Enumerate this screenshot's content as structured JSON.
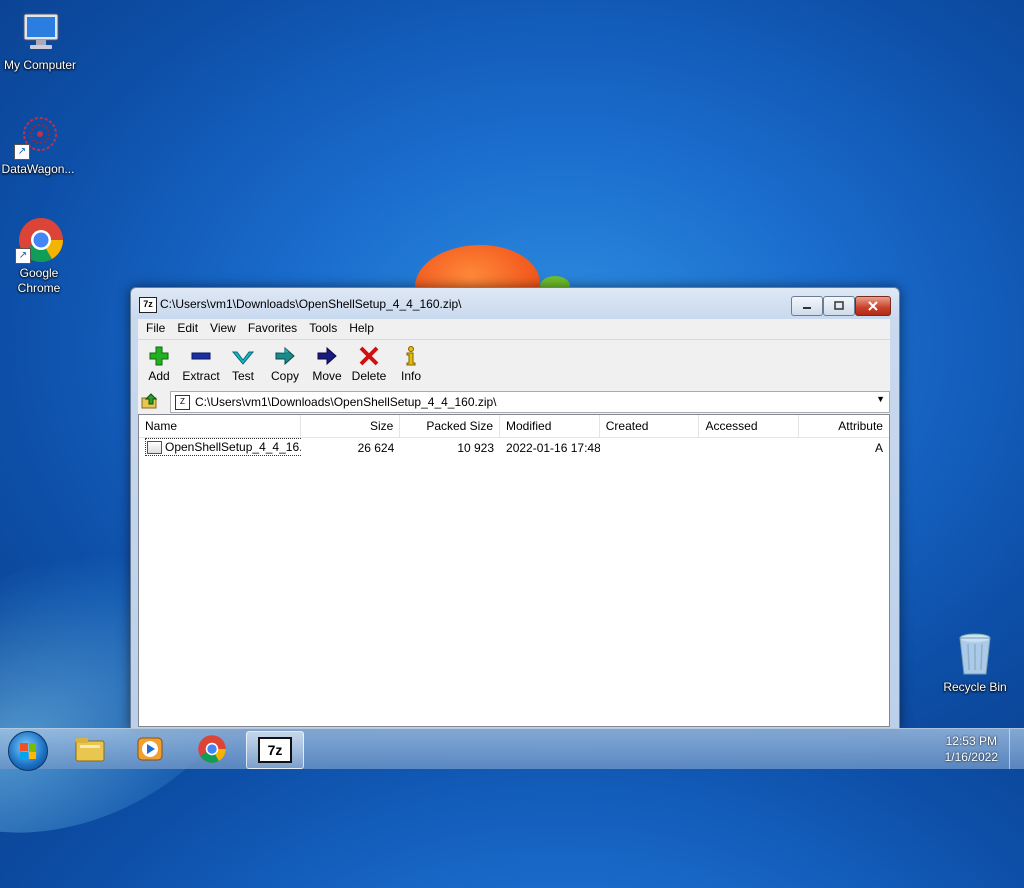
{
  "desktop": {
    "icons": [
      {
        "label": "My Computer"
      },
      {
        "label": "DataWagon..."
      },
      {
        "label": "Google Chrome"
      },
      {
        "label": "Recycle Bin"
      }
    ]
  },
  "window": {
    "title": "C:\\Users\\vm1\\Downloads\\OpenShellSetup_4_4_160.zip\\",
    "app_icon_text": "7z",
    "menu": [
      "File",
      "Edit",
      "View",
      "Favorites",
      "Tools",
      "Help"
    ],
    "toolbar": [
      {
        "label": "Add",
        "icon": "plus-icon"
      },
      {
        "label": "Extract",
        "icon": "minus-icon"
      },
      {
        "label": "Test",
        "icon": "check-icon"
      },
      {
        "label": "Copy",
        "icon": "copy-arrow-icon"
      },
      {
        "label": "Move",
        "icon": "move-arrow-icon"
      },
      {
        "label": "Delete",
        "icon": "delete-x-icon"
      },
      {
        "label": "Info",
        "icon": "info-icon"
      }
    ],
    "address": "C:\\Users\\vm1\\Downloads\\OpenShellSetup_4_4_160.zip\\",
    "columns": [
      "Name",
      "Size",
      "Packed Size",
      "Modified",
      "Created",
      "Accessed",
      "Attribute"
    ],
    "rows": [
      {
        "name": "OpenShellSetup_4_4_16...",
        "size": "26 624",
        "packed": "10 923",
        "modified": "2022-01-16 17:48",
        "created": "",
        "accessed": "",
        "attr": "A"
      }
    ]
  },
  "taskbar": {
    "active_app": "7z",
    "time": "12:53 PM",
    "date": "1/16/2022"
  },
  "colors": {
    "desktop": "#1a6ccd",
    "close_button": "#c7402a",
    "add_icon": "#22b022",
    "extract_icon": "#1a2fa0",
    "test_icon": "#19b7c7",
    "delete_icon": "#d01010"
  }
}
